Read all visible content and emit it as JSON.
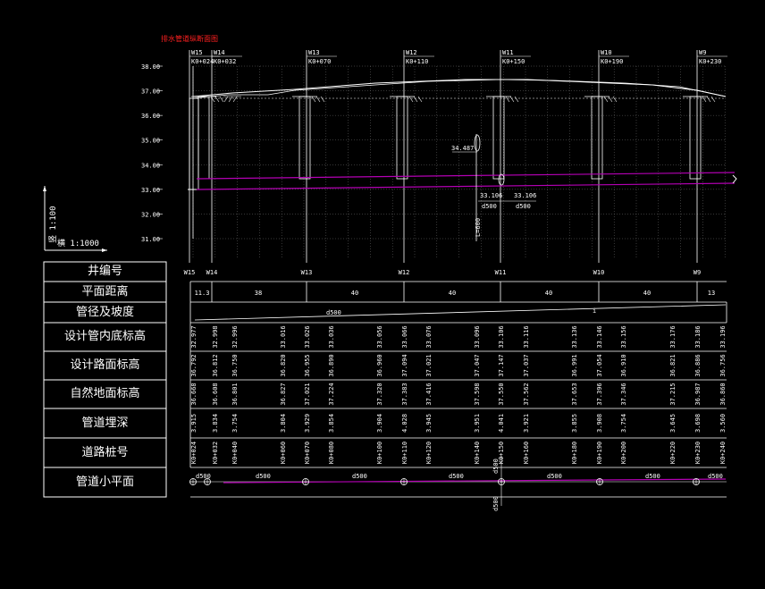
{
  "drawing_title": "排水管道纵断面图",
  "colors": {
    "background": "#000000",
    "line": "#ffffff",
    "grid": "#6e6e6e",
    "pipe": "#b400b4",
    "title": "#ff2020"
  },
  "elev_axis": {
    "ticks": [
      "38.00",
      "37.00",
      "36.00",
      "35.00",
      "34.00",
      "33.00",
      "32.00",
      "31.00"
    ]
  },
  "scale_vertical": "竖 1:100",
  "scale_horizontal": "横 1:1000",
  "stations_top": [
    {
      "name": "W15",
      "stake": "K0+024"
    },
    {
      "name": "W14",
      "stake": "K0+032"
    },
    {
      "name": "W13",
      "stake": "K0+070"
    },
    {
      "name": "W12",
      "stake": "K0+110"
    },
    {
      "name": "W11",
      "stake": "K0+150"
    },
    {
      "name": "W10",
      "stake": "K0+190"
    },
    {
      "name": "W9",
      "stake": "K0+230"
    }
  ],
  "annotation": {
    "elev": "34.487",
    "elev_left": "33.106",
    "elev_right": "33.106",
    "dia_left": "d500",
    "dia_right": "d500",
    "vertical": "L=600"
  },
  "row_headers": [
    "井编号",
    "平面距离",
    "管径及坡度",
    "设计管内底标高",
    "设计路面标高",
    "自然地面标高",
    "管道埋深",
    "道路桩号",
    "管道小平面"
  ],
  "well_numbers": [
    "W15",
    "W14",
    "W13",
    "W12",
    "W11",
    "W10",
    "W9"
  ],
  "distances": [
    "11.3",
    "38",
    "40",
    "40",
    "40",
    "40",
    "13"
  ],
  "pipe_size": "d500",
  "slope_mark": "i",
  "table_columns": [
    {
      "invert": "32.977",
      "road": "36.792",
      "ground": "36.668",
      "depth": "3.915",
      "stake": "K0+024"
    },
    {
      "invert": "32.998",
      "road": "36.812",
      "ground": "36.608",
      "depth": "3.834",
      "stake": "K0+032"
    },
    {
      "invert": "32.996",
      "road": "36.750",
      "ground": "36.801",
      "depth": "3.754",
      "stake": "K0+040"
    },
    {
      "invert": "33.016",
      "road": "36.820",
      "ground": "36.827",
      "depth": "3.804",
      "stake": "K0+060"
    },
    {
      "invert": "33.026",
      "road": "36.955",
      "ground": "37.021",
      "depth": "3.929",
      "stake": "K0+070"
    },
    {
      "invert": "33.036",
      "road": "36.890",
      "ground": "37.224",
      "depth": "3.854",
      "stake": "K0+080"
    },
    {
      "invert": "33.056",
      "road": "36.960",
      "ground": "37.320",
      "depth": "3.904",
      "stake": "K0+100"
    },
    {
      "invert": "33.066",
      "road": "37.094",
      "ground": "37.383",
      "depth": "4.028",
      "stake": "K0+110"
    },
    {
      "invert": "33.076",
      "road": "37.021",
      "ground": "37.416",
      "depth": "3.945",
      "stake": "K0+120"
    },
    {
      "invert": "33.096",
      "road": "37.047",
      "ground": "37.598",
      "depth": "3.951",
      "stake": "K0+140"
    },
    {
      "invert": "33.106",
      "road": "37.147",
      "ground": "37.550",
      "depth": "4.041",
      "stake": "K0+150"
    },
    {
      "invert": "33.116",
      "road": "37.037",
      "ground": "37.562",
      "depth": "3.921",
      "stake": "K0+160"
    },
    {
      "invert": "33.136",
      "road": "36.991",
      "ground": "37.653",
      "depth": "3.855",
      "stake": "K0+180"
    },
    {
      "invert": "33.146",
      "road": "37.054",
      "ground": "37.396",
      "depth": "3.908",
      "stake": "K0+190"
    },
    {
      "invert": "33.156",
      "road": "36.910",
      "ground": "37.346",
      "depth": "3.754",
      "stake": "K0+200"
    },
    {
      "invert": "33.176",
      "road": "36.821",
      "ground": "37.215",
      "depth": "3.645",
      "stake": "K0+220"
    },
    {
      "invert": "33.186",
      "road": "36.886",
      "ground": "36.987",
      "depth": "3.698",
      "stake": "K0+230"
    },
    {
      "invert": "33.196",
      "road": "36.756",
      "ground": "36.860",
      "depth": "3.560",
      "stake": "K0+240"
    }
  ],
  "plan_labels": [
    "d500",
    "d500",
    "d500",
    "d500",
    "d500",
    "d500",
    "d500"
  ],
  "plan_vertical": [
    "d500",
    "d500"
  ]
}
